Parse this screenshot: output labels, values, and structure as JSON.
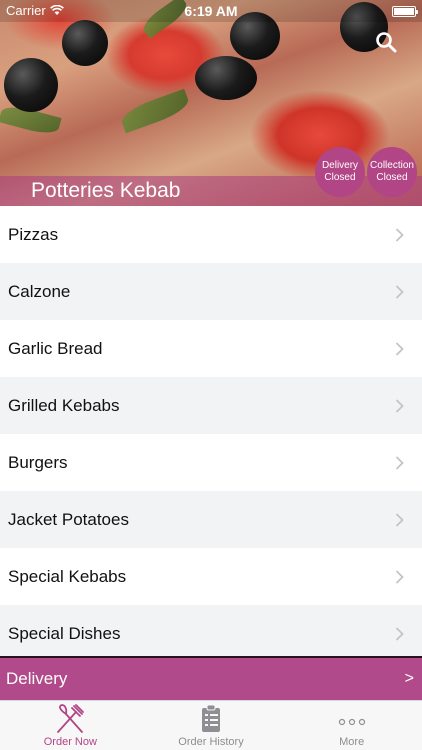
{
  "status_bar": {
    "carrier": "Carrier",
    "time": "6:19 AM"
  },
  "header": {
    "restaurant_name": "Potteries Kebab",
    "delivery_badge": {
      "line1": "Delivery",
      "line2": "Closed"
    },
    "collection_badge": {
      "line1": "Collection",
      "line2": "Closed"
    },
    "search_icon": "search-icon"
  },
  "menu": {
    "items": [
      {
        "label": "Pizzas"
      },
      {
        "label": "Calzone"
      },
      {
        "label": "Garlic Bread"
      },
      {
        "label": "Grilled Kebabs"
      },
      {
        "label": "Burgers"
      },
      {
        "label": "Jacket Potatoes"
      },
      {
        "label": "Special Kebabs"
      },
      {
        "label": "Special Dishes"
      }
    ]
  },
  "order_mode": {
    "label": "Delivery",
    "arrow": ">"
  },
  "tab_bar": {
    "tabs": [
      {
        "label": "Order Now",
        "icon": "fork-knife-icon"
      },
      {
        "label": "Order History",
        "icon": "clipboard-icon"
      },
      {
        "label": "More",
        "icon": "more-dots-icon"
      }
    ]
  },
  "colors": {
    "accent": "#b24585",
    "list_alt": "#f2f3f5",
    "tab_inactive": "#8e8e93"
  }
}
